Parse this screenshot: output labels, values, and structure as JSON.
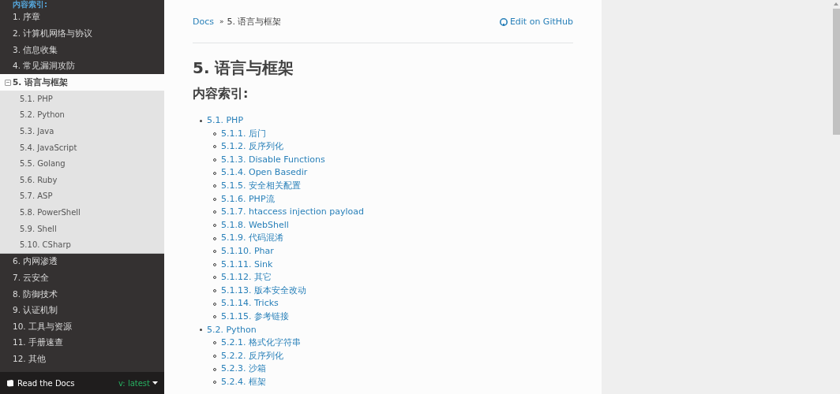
{
  "sidebar": {
    "caption": "内容索引:",
    "items": [
      {
        "label": "1. 序章",
        "selected": false
      },
      {
        "label": "2. 计算机网络与协议",
        "selected": false
      },
      {
        "label": "3. 信息收集",
        "selected": false
      },
      {
        "label": "4. 常见漏洞攻防",
        "selected": false
      },
      {
        "label": "5. 语言与框架",
        "selected": true,
        "children": [
          {
            "label": "5.1. PHP"
          },
          {
            "label": "5.2. Python"
          },
          {
            "label": "5.3. Java"
          },
          {
            "label": "5.4. JavaScript"
          },
          {
            "label": "5.5. Golang"
          },
          {
            "label": "5.6. Ruby"
          },
          {
            "label": "5.7. ASP"
          },
          {
            "label": "5.8. PowerShell"
          },
          {
            "label": "5.9. Shell"
          },
          {
            "label": "5.10. CSharp"
          }
        ]
      },
      {
        "label": "6. 内网渗透",
        "selected": false
      },
      {
        "label": "7. 云安全",
        "selected": false
      },
      {
        "label": "8. 防御技术",
        "selected": false
      },
      {
        "label": "9. 认证机制",
        "selected": false
      },
      {
        "label": "10. 工具与资源",
        "selected": false
      },
      {
        "label": "11. 手册速查",
        "selected": false
      },
      {
        "label": "12. 其他",
        "selected": false
      }
    ],
    "footer": {
      "brand": "Read the Docs",
      "version": "v: latest"
    }
  },
  "breadcrumb": {
    "root": "Docs",
    "separator": "»",
    "current": "5. 语言与框架"
  },
  "edit_link": "Edit on GitHub",
  "title": "5. 语言与框架",
  "subtitle": "内容索引:",
  "toc": [
    {
      "label": "5.1. PHP",
      "children": [
        {
          "label": "5.1.1. 后门"
        },
        {
          "label": "5.1.2. 反序列化"
        },
        {
          "label": "5.1.3. Disable Functions"
        },
        {
          "label": "5.1.4. Open Basedir"
        },
        {
          "label": "5.1.5. 安全相关配置"
        },
        {
          "label": "5.1.6. PHP流"
        },
        {
          "label": "5.1.7. htaccess injection payload"
        },
        {
          "label": "5.1.8. WebShell"
        },
        {
          "label": "5.1.9. 代码混淆"
        },
        {
          "label": "5.1.10. Phar"
        },
        {
          "label": "5.1.11. Sink"
        },
        {
          "label": "5.1.12. 其它"
        },
        {
          "label": "5.1.13. 版本安全改动"
        },
        {
          "label": "5.1.14. Tricks"
        },
        {
          "label": "5.1.15. 参考链接"
        }
      ]
    },
    {
      "label": "5.2. Python",
      "children": [
        {
          "label": "5.2.1. 格式化字符串"
        },
        {
          "label": "5.2.2. 反序列化"
        },
        {
          "label": "5.2.3. 沙箱"
        },
        {
          "label": "5.2.4. 框架"
        }
      ]
    }
  ]
}
